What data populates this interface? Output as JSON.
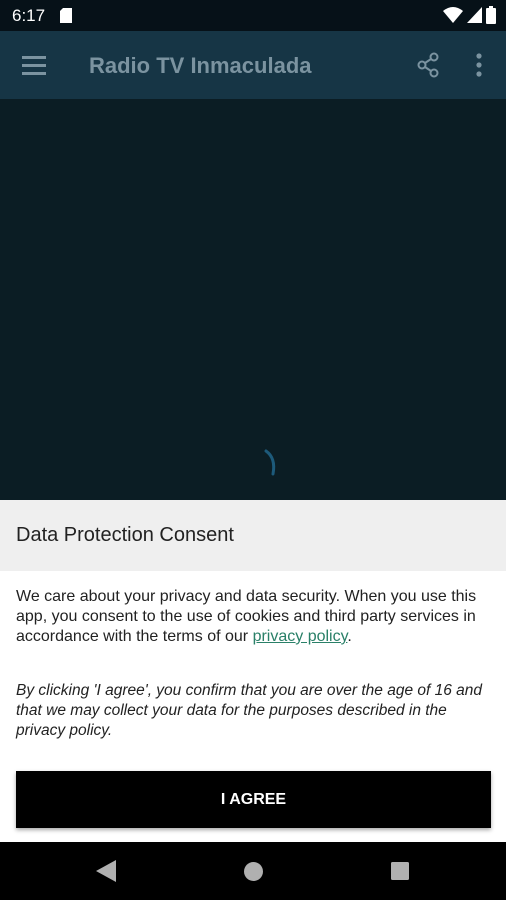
{
  "status_bar": {
    "time": "6:17",
    "icons": [
      "sd-card-icon",
      "wifi-icon",
      "signal-icon",
      "battery-icon"
    ]
  },
  "app_bar": {
    "title": "Radio TV Inmaculada",
    "icons": [
      "menu-icon",
      "share-icon",
      "more-vert-icon"
    ]
  },
  "player": {
    "loading_indicator": "spinner-icon"
  },
  "consent": {
    "title": "Data Protection Consent",
    "body_text": "We care about your privacy and data security. When you use this app, you consent to the use of cookies and third party services in accordance with the terms of our ",
    "privacy_link": "privacy policy",
    "body_end": ".",
    "note": "By clicking 'I agree', you confirm that you are over the age of 16 and that we may collect your data for the purposes described in the privacy policy.",
    "agree_button": "I AGREE",
    "link_color": "#2a8068"
  },
  "nav_bar": {
    "icons": [
      "back-icon",
      "home-icon",
      "recent-apps-icon"
    ]
  },
  "colors": {
    "status_bar": "#061118",
    "app_bar": "#163545",
    "video_bg": "#0b1d24",
    "title_text": "#7b93a0",
    "header_bg": "#efefef",
    "button_bg": "#000000"
  }
}
